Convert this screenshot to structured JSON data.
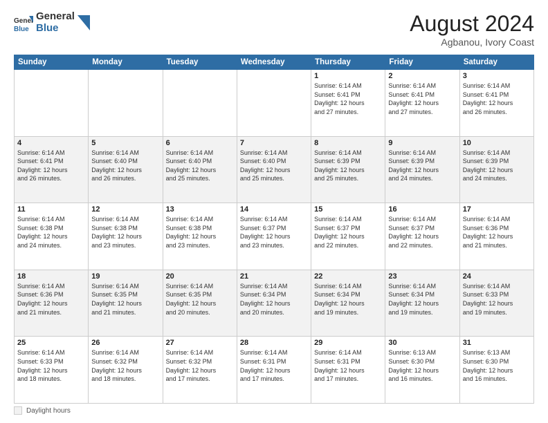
{
  "header": {
    "logo_general": "General",
    "logo_blue": "Blue",
    "month": "August 2024",
    "location": "Agbanou, Ivory Coast"
  },
  "days_of_week": [
    "Sunday",
    "Monday",
    "Tuesday",
    "Wednesday",
    "Thursday",
    "Friday",
    "Saturday"
  ],
  "weeks": [
    [
      {
        "day": "",
        "info": ""
      },
      {
        "day": "",
        "info": ""
      },
      {
        "day": "",
        "info": ""
      },
      {
        "day": "",
        "info": ""
      },
      {
        "day": "1",
        "info": "Sunrise: 6:14 AM\nSunset: 6:41 PM\nDaylight: 12 hours\nand 27 minutes."
      },
      {
        "day": "2",
        "info": "Sunrise: 6:14 AM\nSunset: 6:41 PM\nDaylight: 12 hours\nand 27 minutes."
      },
      {
        "day": "3",
        "info": "Sunrise: 6:14 AM\nSunset: 6:41 PM\nDaylight: 12 hours\nand 26 minutes."
      }
    ],
    [
      {
        "day": "4",
        "info": "Sunrise: 6:14 AM\nSunset: 6:41 PM\nDaylight: 12 hours\nand 26 minutes."
      },
      {
        "day": "5",
        "info": "Sunrise: 6:14 AM\nSunset: 6:40 PM\nDaylight: 12 hours\nand 26 minutes."
      },
      {
        "day": "6",
        "info": "Sunrise: 6:14 AM\nSunset: 6:40 PM\nDaylight: 12 hours\nand 25 minutes."
      },
      {
        "day": "7",
        "info": "Sunrise: 6:14 AM\nSunset: 6:40 PM\nDaylight: 12 hours\nand 25 minutes."
      },
      {
        "day": "8",
        "info": "Sunrise: 6:14 AM\nSunset: 6:39 PM\nDaylight: 12 hours\nand 25 minutes."
      },
      {
        "day": "9",
        "info": "Sunrise: 6:14 AM\nSunset: 6:39 PM\nDaylight: 12 hours\nand 24 minutes."
      },
      {
        "day": "10",
        "info": "Sunrise: 6:14 AM\nSunset: 6:39 PM\nDaylight: 12 hours\nand 24 minutes."
      }
    ],
    [
      {
        "day": "11",
        "info": "Sunrise: 6:14 AM\nSunset: 6:38 PM\nDaylight: 12 hours\nand 24 minutes."
      },
      {
        "day": "12",
        "info": "Sunrise: 6:14 AM\nSunset: 6:38 PM\nDaylight: 12 hours\nand 23 minutes."
      },
      {
        "day": "13",
        "info": "Sunrise: 6:14 AM\nSunset: 6:38 PM\nDaylight: 12 hours\nand 23 minutes."
      },
      {
        "day": "14",
        "info": "Sunrise: 6:14 AM\nSunset: 6:37 PM\nDaylight: 12 hours\nand 23 minutes."
      },
      {
        "day": "15",
        "info": "Sunrise: 6:14 AM\nSunset: 6:37 PM\nDaylight: 12 hours\nand 22 minutes."
      },
      {
        "day": "16",
        "info": "Sunrise: 6:14 AM\nSunset: 6:37 PM\nDaylight: 12 hours\nand 22 minutes."
      },
      {
        "day": "17",
        "info": "Sunrise: 6:14 AM\nSunset: 6:36 PM\nDaylight: 12 hours\nand 21 minutes."
      }
    ],
    [
      {
        "day": "18",
        "info": "Sunrise: 6:14 AM\nSunset: 6:36 PM\nDaylight: 12 hours\nand 21 minutes."
      },
      {
        "day": "19",
        "info": "Sunrise: 6:14 AM\nSunset: 6:35 PM\nDaylight: 12 hours\nand 21 minutes."
      },
      {
        "day": "20",
        "info": "Sunrise: 6:14 AM\nSunset: 6:35 PM\nDaylight: 12 hours\nand 20 minutes."
      },
      {
        "day": "21",
        "info": "Sunrise: 6:14 AM\nSunset: 6:34 PM\nDaylight: 12 hours\nand 20 minutes."
      },
      {
        "day": "22",
        "info": "Sunrise: 6:14 AM\nSunset: 6:34 PM\nDaylight: 12 hours\nand 19 minutes."
      },
      {
        "day": "23",
        "info": "Sunrise: 6:14 AM\nSunset: 6:34 PM\nDaylight: 12 hours\nand 19 minutes."
      },
      {
        "day": "24",
        "info": "Sunrise: 6:14 AM\nSunset: 6:33 PM\nDaylight: 12 hours\nand 19 minutes."
      }
    ],
    [
      {
        "day": "25",
        "info": "Sunrise: 6:14 AM\nSunset: 6:33 PM\nDaylight: 12 hours\nand 18 minutes."
      },
      {
        "day": "26",
        "info": "Sunrise: 6:14 AM\nSunset: 6:32 PM\nDaylight: 12 hours\nand 18 minutes."
      },
      {
        "day": "27",
        "info": "Sunrise: 6:14 AM\nSunset: 6:32 PM\nDaylight: 12 hours\nand 17 minutes."
      },
      {
        "day": "28",
        "info": "Sunrise: 6:14 AM\nSunset: 6:31 PM\nDaylight: 12 hours\nand 17 minutes."
      },
      {
        "day": "29",
        "info": "Sunrise: 6:14 AM\nSunset: 6:31 PM\nDaylight: 12 hours\nand 17 minutes."
      },
      {
        "day": "30",
        "info": "Sunrise: 6:13 AM\nSunset: 6:30 PM\nDaylight: 12 hours\nand 16 minutes."
      },
      {
        "day": "31",
        "info": "Sunrise: 6:13 AM\nSunset: 6:30 PM\nDaylight: 12 hours\nand 16 minutes."
      }
    ]
  ],
  "legend": {
    "label": "Daylight hours"
  }
}
